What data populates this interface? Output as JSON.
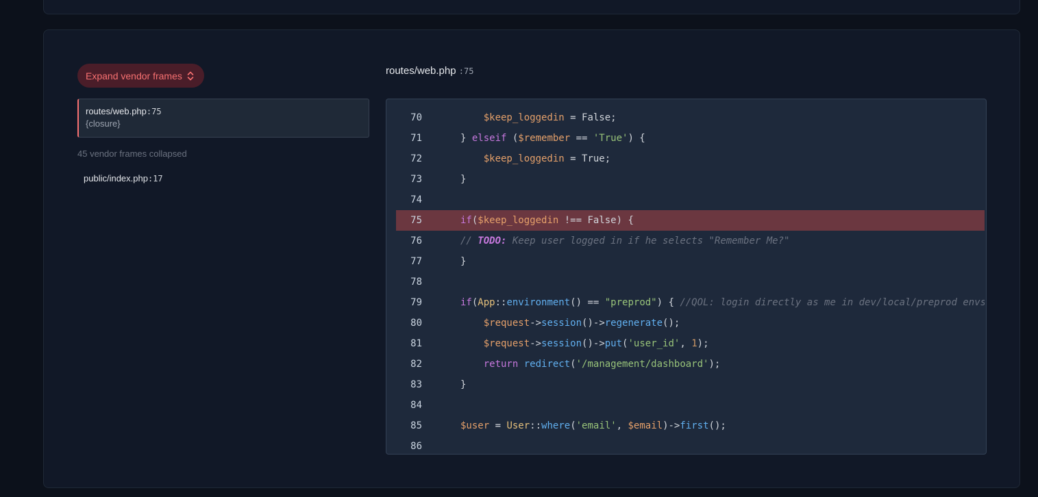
{
  "sidebar": {
    "expand_button_label": "Expand vendor frames",
    "active_frame": {
      "file": "routes/web.php",
      "line": ":75",
      "function": "{closure}"
    },
    "collapsed_note": "45 vendor frames collapsed",
    "other_frame": {
      "file": "public/index.php",
      "line": ":17"
    }
  },
  "code_header": {
    "file": "routes/web.php",
    "line": ":75"
  },
  "code": {
    "highlight_line": 75,
    "line_numbers": [
      "70",
      "71",
      "72",
      "73",
      "74",
      "75",
      "76",
      "77",
      "78",
      "79",
      "80",
      "81",
      "82",
      "83",
      "84",
      "85",
      "86"
    ]
  },
  "colors": {
    "accent": "#f87171",
    "highlight_bg": "#6b3740",
    "code_bg": "#1e293b"
  }
}
